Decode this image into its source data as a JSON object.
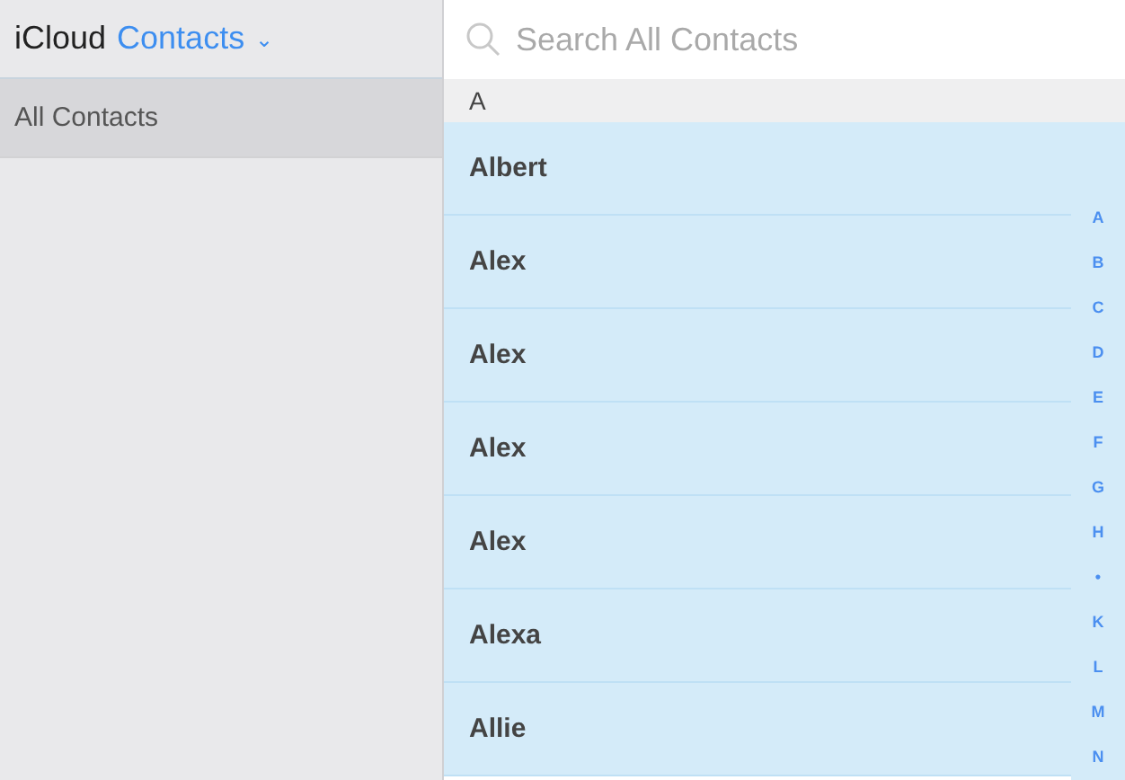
{
  "header": {
    "app": "iCloud",
    "section": "Contacts",
    "caret": "⌄"
  },
  "sidebar": {
    "items": [
      {
        "label": "All Contacts",
        "selected": true
      }
    ]
  },
  "search": {
    "placeholder": "Search All Contacts"
  },
  "list": {
    "section": "A",
    "rows": [
      {
        "name": "Albert",
        "selected": true
      },
      {
        "name": "Alex",
        "selected": true
      },
      {
        "name": "Alex",
        "selected": true
      },
      {
        "name": "Alex",
        "selected": true
      },
      {
        "name": "Alex",
        "selected": true
      },
      {
        "name": "Alexa",
        "selected": true
      },
      {
        "name": "Allie",
        "selected": true
      }
    ]
  },
  "index": [
    "A",
    "B",
    "C",
    "D",
    "E",
    "F",
    "G",
    "H",
    "•",
    "K",
    "L",
    "M",
    "N"
  ]
}
